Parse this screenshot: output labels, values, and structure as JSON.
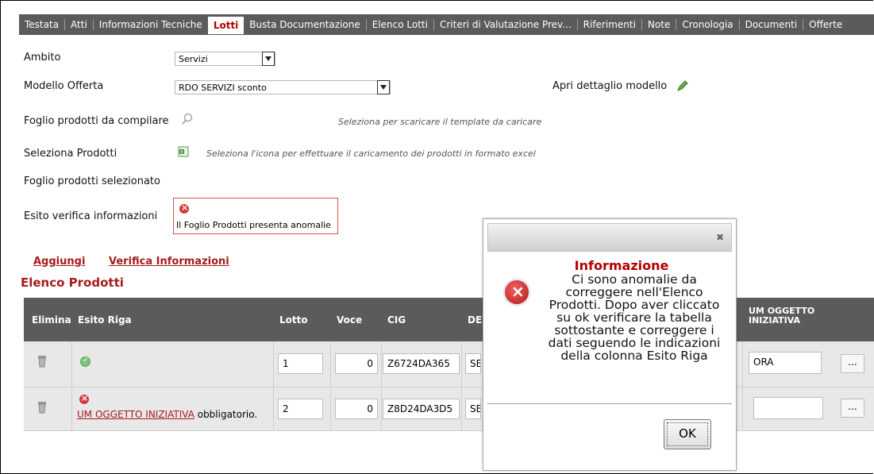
{
  "tabs": [
    "Testata",
    "Atti",
    "Informazioni Tecniche",
    "Lotti",
    "Busta Documentazione",
    "Elenco Lotti",
    "Criteri di Valutazione Prev...",
    "Riferimenti",
    "Note",
    "Cronologia",
    "Documenti",
    "Offerte"
  ],
  "active_tab": "Lotti",
  "form": {
    "ambito_label": "Ambito",
    "ambito_value": "Servizi",
    "modello_label": "Modello Offerta",
    "modello_value": "RDO SERVIZI sconto",
    "apri_dettaglio": "Apri dettaglio modello",
    "foglio_label": "Foglio prodotti da compilare",
    "foglio_hint": "Seleziona per scaricare il template da caricare",
    "seleziona_label": "Seleziona Prodotti",
    "seleziona_hint": "Seleziona l'icona per effettuare il caricamento dei prodotti in formato excel",
    "foglio_sel_label": "Foglio prodotti selezionato",
    "esito_label": "Esito verifica informazioni",
    "esito_msg": "Il Foglio Prodotti presenta anomalie"
  },
  "actions": {
    "aggiungi": "Aggiungi",
    "verifica": "Verifica Informazioni"
  },
  "section_title": "Elenco Prodotti",
  "table": {
    "headers": {
      "elimina": "Elimina",
      "esito": "Esito Riga",
      "lotto": "Lotto",
      "voce": "Voce",
      "cig": "CIG",
      "de": "DE",
      "um1": "UM OGGETTO",
      "um2": "INIZIATIVA"
    },
    "rows": [
      {
        "lotto": "1",
        "voce": "0",
        "cig": "Z6724DA365",
        "de": "SE",
        "um": "ORA",
        "dots": "...",
        "status": "ok"
      },
      {
        "lotto": "2",
        "voce": "0",
        "cig": "Z8D24DA3D5",
        "de": "SE",
        "um": "",
        "dots": "...",
        "status": "error",
        "error_link": "UM OGGETTO INIZIATIVA",
        "error_text": " obbligatorio."
      }
    ]
  },
  "modal": {
    "title": "Informazione",
    "message": "Ci sono anomalie da correggere nell'Elenco Prodotti. Dopo aver cliccato su ok verificare la tabella sottostante e correggere i dati seguendo le indicazioni della colonna Esito Riga",
    "ok": "OK"
  },
  "colors": {
    "accent": "#a61b1b",
    "header_bg": "#5b5b5b",
    "row_bg": "#e8e8e8"
  },
  "icons": [
    "search-icon",
    "excel-icon",
    "pencil-icon",
    "error-icon",
    "success-icon",
    "trash-icon",
    "close-icon"
  ]
}
